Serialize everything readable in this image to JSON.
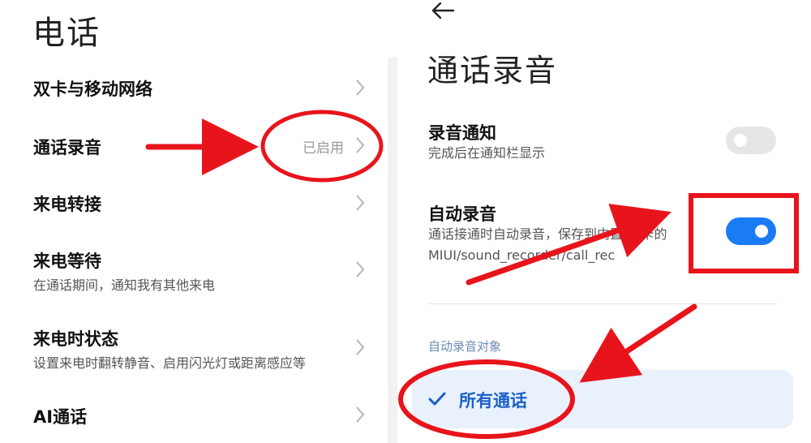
{
  "left": {
    "title": "电话",
    "items": [
      {
        "title": "双卡与移动网络"
      },
      {
        "title": "通话录音",
        "value": "已启用"
      },
      {
        "title": "来电转接"
      },
      {
        "title": "来电等待",
        "subtitle": "在通话期间，通知我有其他来电"
      },
      {
        "title": "来电时状态",
        "subtitle": "设置来电时翻转静音、启用闪光灯或距离感应等"
      },
      {
        "title": "AI通话"
      }
    ]
  },
  "right": {
    "title": "通话录音",
    "settings": [
      {
        "title": "录音通知",
        "subtitle": "完成后在通知栏显示",
        "enabled": false
      },
      {
        "title": "自动录音",
        "subtitle": "通话接通时自动录音，保存到内置SD卡的 MIUI/sound_recorder/call_rec",
        "enabled": true
      }
    ],
    "section_label": "自动录音对象",
    "selected_option": "所有通话"
  },
  "colors": {
    "accent": "#1a7cf5",
    "annotation": "#e8141c",
    "selected_bg": "#e8f1fc"
  },
  "icons": {
    "back": "arrow-left-icon",
    "chevron": "chevron-right-icon",
    "check": "checkmark-icon"
  }
}
